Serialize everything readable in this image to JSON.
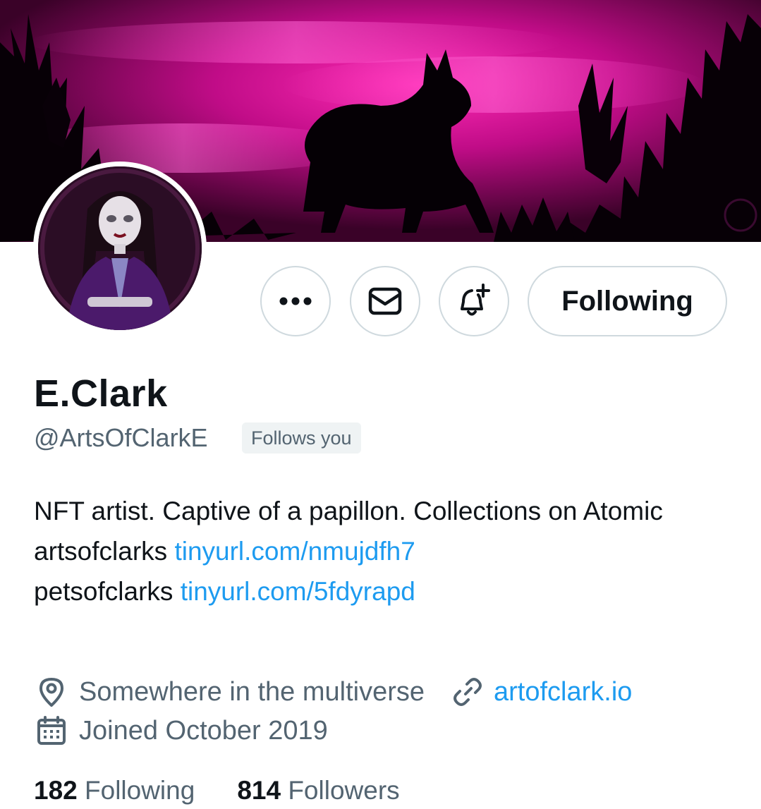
{
  "profile": {
    "name": "E.Clark",
    "handle": "@ArtsOfClarkE",
    "follows_you_badge": "Follows you",
    "bio": {
      "line1": "NFT artist. Captive of a papillon. Collections on Atomic",
      "line2_prefix": "artsofclarks",
      "line2_link": "tinyurl.com/nmujdfh7",
      "line3_prefix": "petsofclarks",
      "line3_link": "tinyurl.com/5fdyrapd"
    },
    "location": "Somewhere in the multiverse",
    "website": "artofclark.io",
    "joined": "Joined October 2019",
    "stats": {
      "following_count": "182",
      "following_label": "Following",
      "followers_count": "814",
      "followers_label": "Followers"
    }
  },
  "actions": {
    "more_icon": "more-dots-icon",
    "message_icon": "envelope-icon",
    "notify_icon": "bell-plus-icon",
    "follow_button_label": "Following"
  },
  "icons": {
    "location": "location-pin-icon",
    "website": "link-icon",
    "joined": "calendar-icon"
  },
  "colors": {
    "link": "#1d9bf0",
    "text_primary": "#0f1419",
    "text_secondary": "#536471",
    "border": "#cfd9de",
    "banner_magenta": "#e0119a"
  }
}
